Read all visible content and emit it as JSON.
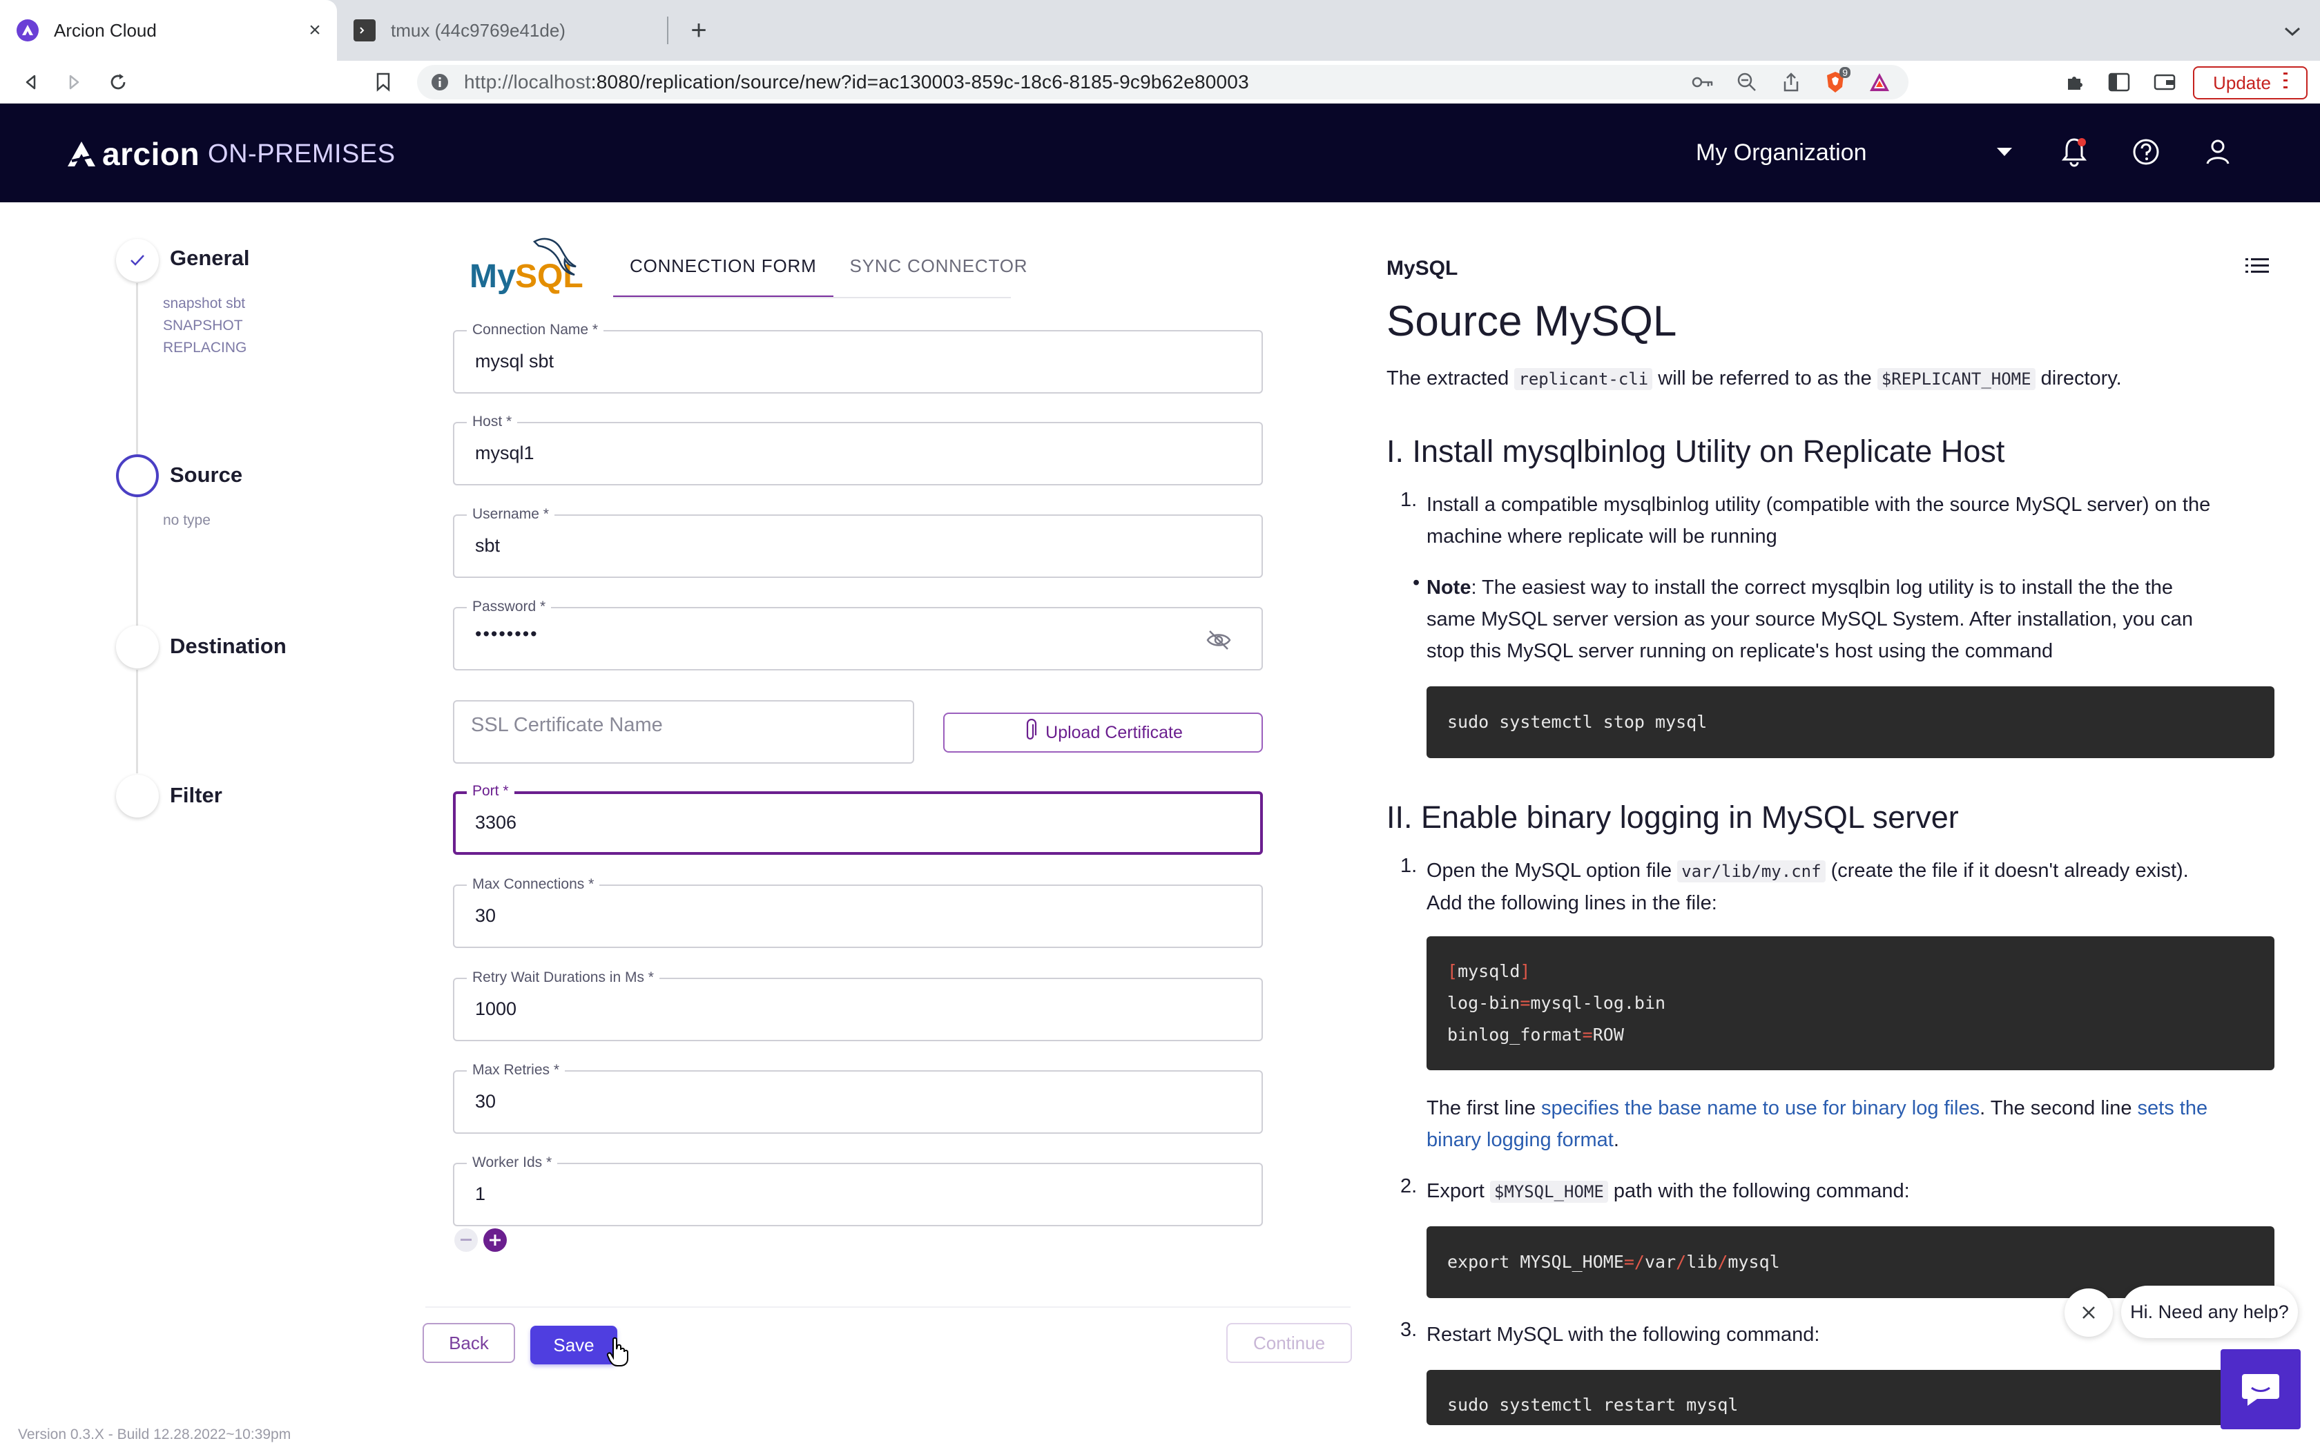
{
  "browser": {
    "tabs": [
      {
        "title": "Arcion Cloud",
        "active": true,
        "icon": "arcion-favicon"
      },
      {
        "title": "tmux (44c9769e41de)",
        "active": false,
        "icon": "terminal-favicon"
      }
    ],
    "url_host": "http://localhost",
    "url_rest": ":8080/replication/source/new?id=ac130003-859c-18c6-8185-9c9b62e80003",
    "update_label": "Update",
    "brave_badge": "9"
  },
  "header": {
    "brand": "arcion",
    "edition": "ON-PREMISES",
    "organization": "My Organization"
  },
  "stepper": {
    "steps": [
      {
        "label": "General",
        "status": "done",
        "sub": [
          "snapshot sbt",
          "SNAPSHOT",
          "REPLACING"
        ]
      },
      {
        "label": "Source",
        "status": "current",
        "sub": [
          "no type"
        ]
      },
      {
        "label": "Destination",
        "status": "pending",
        "sub": []
      },
      {
        "label": "Filter",
        "status": "pending",
        "sub": []
      }
    ]
  },
  "form": {
    "tabs": [
      "CONNECTION FORM",
      "SYNC CONNECTOR"
    ],
    "active_tab": "CONNECTION FORM",
    "fields": [
      {
        "label": "Connection Name *",
        "value": "mysql sbt"
      },
      {
        "label": "Host *",
        "value": "mysql1"
      },
      {
        "label": "Username *",
        "value": "sbt"
      },
      {
        "label": "Password *",
        "value": "••••••••"
      },
      {
        "label": "Port *",
        "value": "3306",
        "focused": true
      },
      {
        "label": "Max Connections *",
        "value": "30"
      },
      {
        "label": "Retry Wait Durations in Ms *",
        "value": "1000"
      },
      {
        "label": "Max Retries *",
        "value": "30"
      },
      {
        "label": "Worker Ids *",
        "value": "1"
      }
    ],
    "ssl_placeholder": "SSL Certificate Name",
    "upload_label": "Upload Certificate",
    "back_label": "Back",
    "save_label": "Save",
    "continue_label": "Continue"
  },
  "version": "Version 0.3.X - Build 12.28.2022~10:39pm",
  "docs": {
    "crumb": "MySQL",
    "title": "Source MySQL",
    "intro_pre": "The extracted ",
    "intro_code1": "replicant-cli",
    "intro_mid": " will be referred to as the ",
    "intro_code2": "$REPLICANT_HOME",
    "intro_post": " directory.",
    "h1": "I. Install mysqlbinlog Utility on Replicate Host",
    "step1_line1": "Install a compatible mysqlbinlog utility (compatible with the source MySQL server) on the",
    "step1_line2": "machine where replicate will be running",
    "note_label": "Note",
    "note_line1": ": The easiest way to install the correct mysqlbin log utility is to install the the the",
    "note_line2": "same MySQL server version as your source MySQL System. After installation, you can",
    "note_line3": "stop this MySQL server running on replicate's host using the command",
    "code1": "sudo systemctl stop mysql",
    "h2": "II. Enable binary logging in MySQL server",
    "opt_pre": "Open the MySQL option file ",
    "opt_code": "var/lib/my.cnf",
    "opt_post": " (create the file if it doesn't already exist).",
    "opt_line2": "Add the following lines in the file:",
    "cnf_section": "mysqld",
    "cnf_line2_key": "log-bin",
    "cnf_line2_val": "mysql-log.bin",
    "cnf_line3_key": "binlog_format",
    "cnf_line3_val": "ROW",
    "first_line_pre": "The first line ",
    "first_line_link": "specifies the base name to use for binary log files",
    "first_line_mid": ". The second line ",
    "first_line_link2a": "sets the",
    "first_line_link2b": "binary logging format",
    "first_line_end": ".",
    "export_pre": "Export ",
    "export_code": "$MYSQL_HOME",
    "export_post": " path with the following command:",
    "export_cmd_a": "export MYSQL_HOME",
    "export_cmd_b": "var",
    "export_cmd_c": "lib",
    "export_cmd_d": "mysql",
    "restart_text": "Restart MySQL with the following command:",
    "restart_cmd": "sudo systemctl restart mysql"
  },
  "chat": {
    "bubble": "Hi. Need any help?"
  },
  "colors": {
    "header_bg": "#080628",
    "accent_purple": "#6b1f8f",
    "save_blue": "#4f3ee0",
    "step_current": "#4a3fc4"
  }
}
